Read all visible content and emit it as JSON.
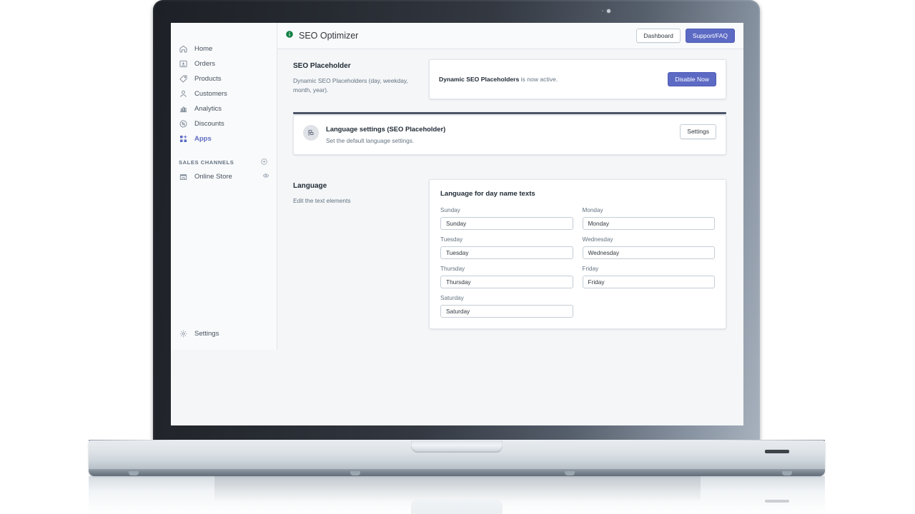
{
  "sidebar": {
    "items": [
      {
        "label": "Home",
        "icon": "home-icon",
        "active": false
      },
      {
        "label": "Orders",
        "icon": "orders-icon",
        "active": false
      },
      {
        "label": "Products",
        "icon": "products-tag-icon",
        "active": false
      },
      {
        "label": "Customers",
        "icon": "customers-person-icon",
        "active": false
      },
      {
        "label": "Analytics",
        "icon": "analytics-bars-icon",
        "active": false
      },
      {
        "label": "Discounts",
        "icon": "discounts-percent-icon",
        "active": false
      },
      {
        "label": "Apps",
        "icon": "apps-grid-icon",
        "active": true
      }
    ],
    "sales_channels": {
      "label": "SALES CHANNELS",
      "add_icon": "plus-circle-icon",
      "items": [
        {
          "label": "Online Store",
          "icon": "store-icon",
          "trailing_icon": "eye-icon"
        }
      ]
    },
    "settings": {
      "label": "Settings",
      "icon": "gear-icon"
    }
  },
  "topbar": {
    "info_icon": "info-circle-icon",
    "title": "SEO Optimizer",
    "dashboard_label": "Dashboard",
    "support_label": "Support/FAQ"
  },
  "seo_placeholder": {
    "title": "SEO Placeholder",
    "description": "Dynamic SEO Placeholders (day, weekday, month, year).",
    "status_strong": "Dynamic SEO Placeholders",
    "status_rest": " is now active.",
    "disable_label": "Disable Now"
  },
  "language_settings_card": {
    "icon": "flag-icon",
    "title": "Language settings (SEO Placeholder)",
    "subtitle": "Set the default language settings.",
    "settings_label": "Settings"
  },
  "language": {
    "title": "Language",
    "description": "Edit the text elements",
    "form_title": "Language for day name texts",
    "fields": [
      {
        "label": "Sunday",
        "value": "Sunday"
      },
      {
        "label": "Monday",
        "value": "Monday"
      },
      {
        "label": "Tuesday",
        "value": "Tuesday"
      },
      {
        "label": "Wednesday",
        "value": "Wednesday"
      },
      {
        "label": "Thursday",
        "value": "Thursday"
      },
      {
        "label": "Friday",
        "value": "Friday"
      },
      {
        "label": "Saturday",
        "value": "Saturday"
      }
    ]
  },
  "colors": {
    "accent": "#5c6ac4",
    "info_green": "#108043",
    "page_bg": "#f4f6f8",
    "text_primary": "#212b36",
    "text_secondary": "#637381"
  }
}
